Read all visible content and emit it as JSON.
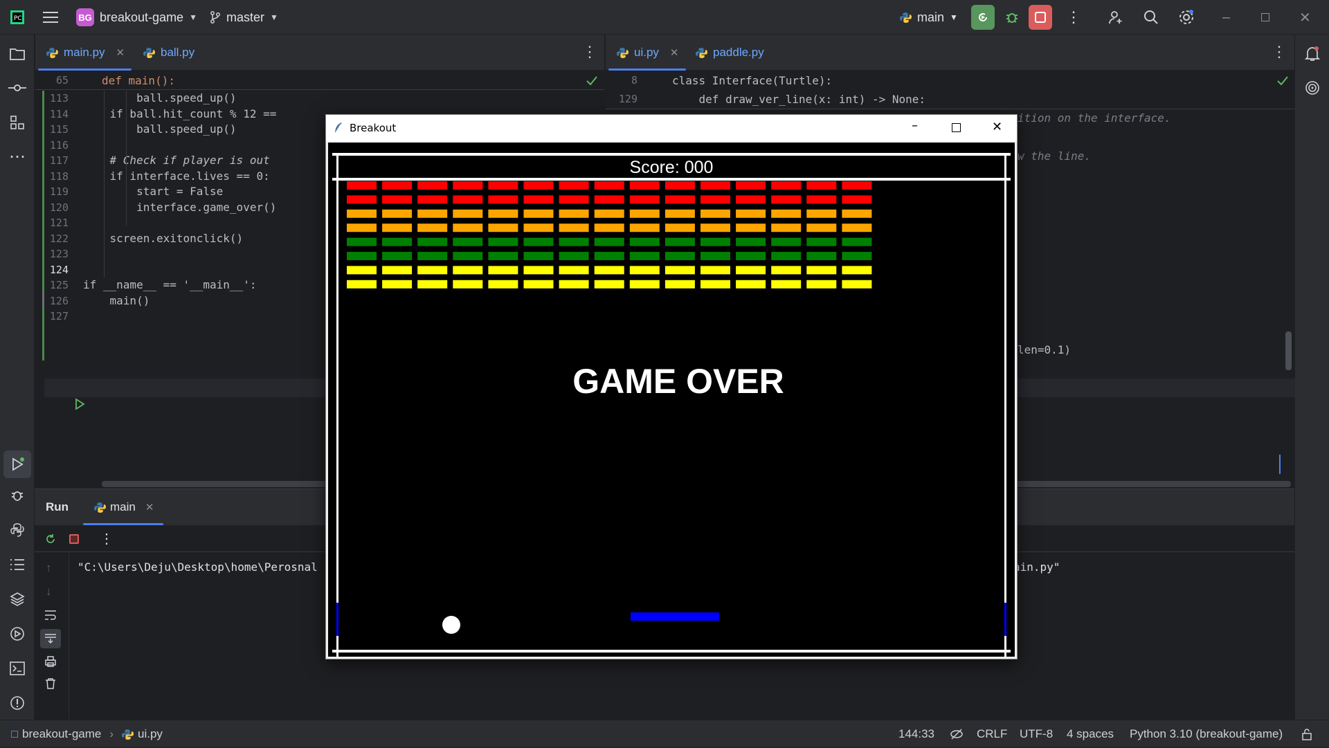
{
  "titlebar": {
    "project_badge": "BG",
    "project_name": "breakout-game",
    "branch": "master",
    "run_config": "main"
  },
  "left_editor": {
    "tabs": [
      {
        "label": "main.py",
        "active": true
      },
      {
        "label": "ball.py",
        "active": false
      }
    ],
    "sticky": {
      "num": "65",
      "text": "def main():"
    },
    "lines": [
      {
        "num": "113",
        "text": "        ball.speed_up()"
      },
      {
        "num": "114",
        "text": "    if ball.hit_count % 12 =="
      },
      {
        "num": "115",
        "text": "        ball.speed_up()"
      },
      {
        "num": "116",
        "text": ""
      },
      {
        "num": "117",
        "text": "    # Check if player is out"
      },
      {
        "num": "118",
        "text": "    if interface.lives == 0:"
      },
      {
        "num": "119",
        "text": "        start = False"
      },
      {
        "num": "120",
        "text": "        interface.game_over()"
      },
      {
        "num": "121",
        "text": ""
      },
      {
        "num": "122",
        "text": "    screen.exitonclick()"
      },
      {
        "num": "123",
        "text": ""
      },
      {
        "num": "124",
        "text": ""
      },
      {
        "num": "125",
        "text": "if __name__ == '__main__':"
      },
      {
        "num": "126",
        "text": "    main()"
      },
      {
        "num": "127",
        "text": ""
      }
    ]
  },
  "right_editor": {
    "tabs": [
      {
        "label": "ui.py",
        "active": true
      },
      {
        "label": "paddle.py",
        "active": false
      }
    ],
    "sticky": [
      {
        "num": "8",
        "text": "class Interface(Turtle):"
      },
      {
        "num": "129",
        "text": "    def draw_ver_line(x: int) -> None:"
      }
    ],
    "fragments": [
      {
        "text": "ition on the interface."
      },
      {
        "text": "w the line."
      },
      {
        "text": "len=0.1)"
      }
    ]
  },
  "run_panel": {
    "title": "Run",
    "tab_label": "main",
    "output_start": "\"C:\\Users\\Deju\\Desktop\\home\\Perosnal",
    "output_end": "ain.py\""
  },
  "statusbar": {
    "project": "breakout-game",
    "file": "ui.py",
    "position": "144:33",
    "line_ending": "CRLF",
    "encoding": "UTF-8",
    "indent": "4 spaces",
    "interpreter": "Python 3.10 (breakout-game)"
  },
  "game_window": {
    "title": "Breakout",
    "score_text": "Score: 000",
    "game_over_text": "GAME OVER",
    "brick_columns": 15,
    "brick_rows": [
      "#ff0000",
      "#ff0000",
      "#ffa500",
      "#ffa500",
      "#008000",
      "#008000",
      "#ffff00",
      "#ffff00"
    ],
    "paddle_color": "#0000ff",
    "ball_color": "#ffffff"
  },
  "icons": {
    "left_toolbar": [
      "folder-icon",
      "commit-icon",
      "structure-icon",
      "more-icon",
      "run-icon",
      "debug-icon",
      "python-console-icon",
      "todo-icon",
      "layers-icon",
      "services-icon",
      "terminal-icon",
      "problems-icon",
      "git-icon"
    ],
    "right_toolbar": [
      "notifications-icon",
      "ai-assistant-icon"
    ]
  }
}
